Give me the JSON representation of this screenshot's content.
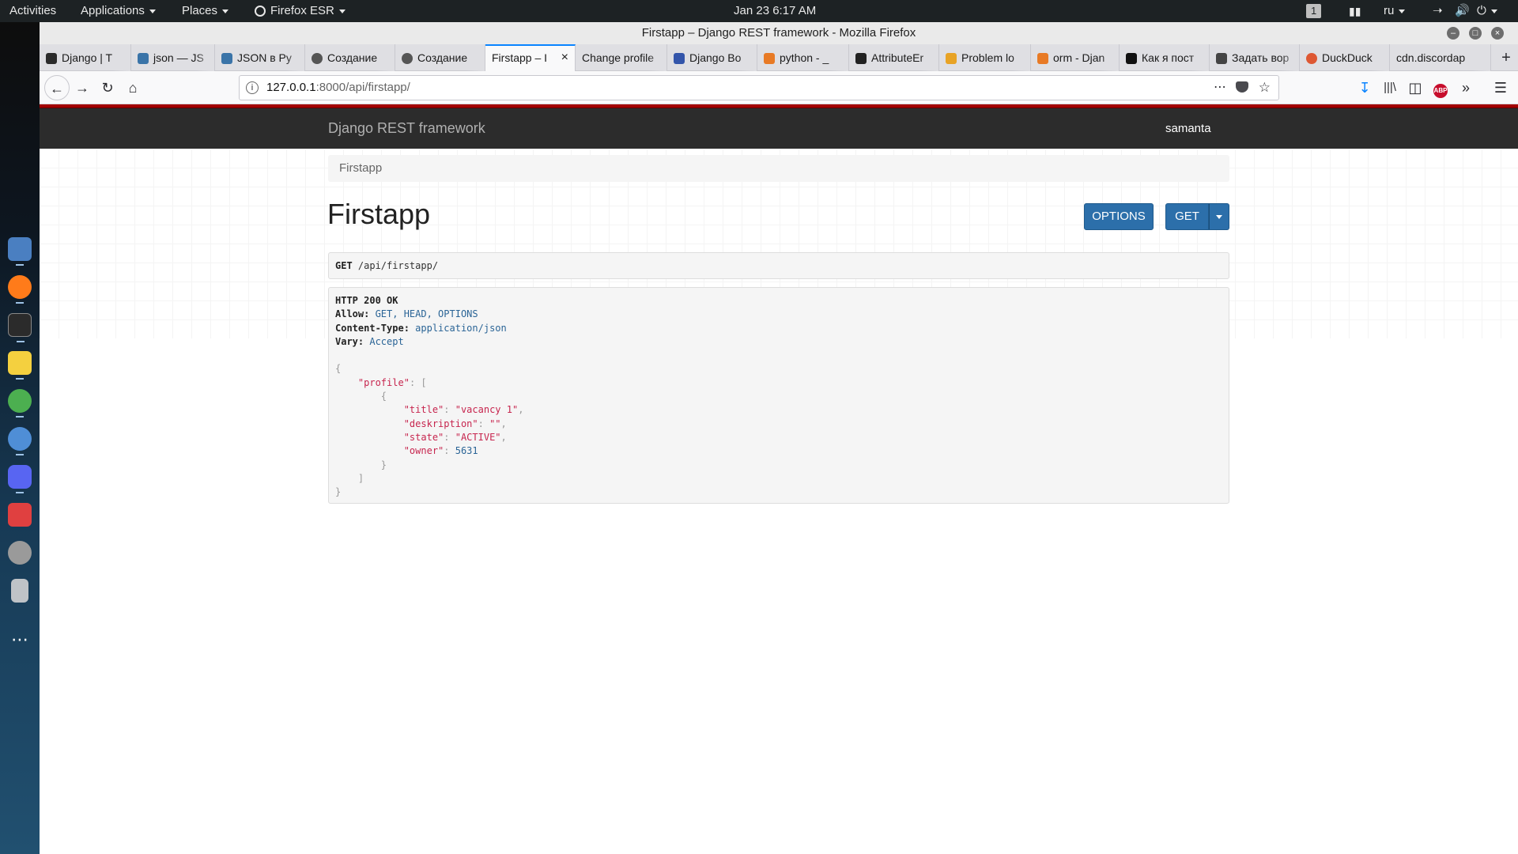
{
  "topbar": {
    "activities": "Activities",
    "applications": "Applications",
    "places": "Places",
    "app_name": "Firefox ESR",
    "clock": "Jan 23   6:17 AM",
    "workspace": "1",
    "language": "ru"
  },
  "dock": {
    "apps": [
      "files",
      "firefox",
      "terminal",
      "text-editor",
      "atom",
      "chromium",
      "discord",
      "screenshot",
      "disks",
      "trash",
      "show-applications"
    ]
  },
  "window": {
    "title": "Firstapp – Django REST framework - Mozilla Firefox"
  },
  "tabs": [
    {
      "label": "Django | T",
      "color": "#2b2b2b"
    },
    {
      "label": "json — JS",
      "color": "#3a74a8"
    },
    {
      "label": "JSON в Py",
      "color": "#3a74a8"
    },
    {
      "label": "Создание",
      "color": "#555555"
    },
    {
      "label": "Создание",
      "color": "#555555"
    },
    {
      "label": "Firstapp – I",
      "color": "#ffffff",
      "active": true
    },
    {
      "label": "Change profile",
      "color": "#ffffff"
    },
    {
      "label": "Django Bo",
      "color": "#3355aa"
    },
    {
      "label": "python - _",
      "color": "#e87a25"
    },
    {
      "label": "AttributeEr",
      "color": "#222222"
    },
    {
      "label": "Problem lo",
      "color": "#e8a325"
    },
    {
      "label": "orm - Djan",
      "color": "#e87a25"
    },
    {
      "label": "Как я пост",
      "color": "#111111"
    },
    {
      "label": "Задать вор",
      "color": "#444444"
    },
    {
      "label": "DuckDuck",
      "color": "#de5833"
    },
    {
      "label": "cdn.discordap",
      "color": "#ffffff"
    }
  ],
  "navbar": {
    "url_host": "127.0.0.1",
    "url_path": ":8000/api/firstapp/"
  },
  "drf": {
    "brand": "Django REST framework",
    "user": "samanta",
    "breadcrumb": "Firstapp",
    "title": "Firstapp",
    "options_button": "OPTIONS",
    "get_button": "GET",
    "request_method": "GET",
    "request_path": " /api/firstapp/",
    "response": {
      "status": "HTTP 200 OK",
      "allow_label": "Allow:",
      "allow_value": " GET, HEAD, OPTIONS",
      "content_type_label": "Content-Type:",
      "content_type_value": " application/json",
      "vary_label": "Vary:",
      "vary_value": " Accept"
    },
    "json": {
      "profile_key": "\"profile\"",
      "title_key": "\"title\"",
      "title_value": "\"vacancy 1\"",
      "deskription_key": "\"deskription\"",
      "deskription_value": "\"\"",
      "state_key": "\"state\"",
      "state_value": "\"ACTIVE\"",
      "owner_key": "\"owner\"",
      "owner_value": "5631"
    }
  }
}
